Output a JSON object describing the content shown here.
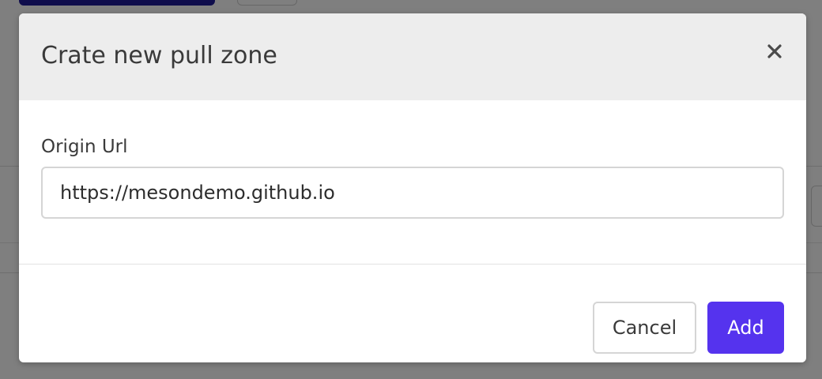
{
  "modal": {
    "title": "Crate new pull zone",
    "close_icon": "close-icon",
    "field": {
      "label": "Origin Url",
      "value": "https://mesondemo.github.io"
    },
    "buttons": {
      "cancel_label": "Cancel",
      "add_label": "Add"
    }
  },
  "colors": {
    "primary": "#5533ee",
    "header_bg": "#ededed",
    "text": "#3a3a3a",
    "border": "#d5d5d5"
  }
}
